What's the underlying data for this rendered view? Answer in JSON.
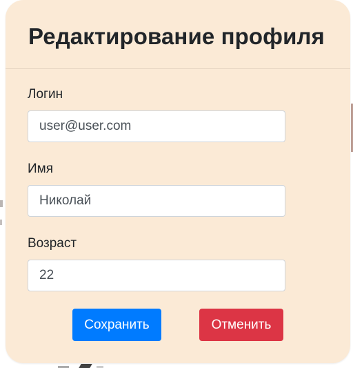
{
  "modal": {
    "title": "Редактирование профиля"
  },
  "form": {
    "login": {
      "label": "Логин",
      "value": "user@user.com"
    },
    "name": {
      "label": "Имя",
      "value": "Николай"
    },
    "age": {
      "label": "Возраст",
      "value": "22"
    }
  },
  "actions": {
    "save_label": "Сохранить",
    "cancel_label": "Отменить"
  },
  "colors": {
    "modal_background": "#fbead6",
    "primary": "#007bff",
    "danger": "#dc3545",
    "text": "#212529"
  }
}
